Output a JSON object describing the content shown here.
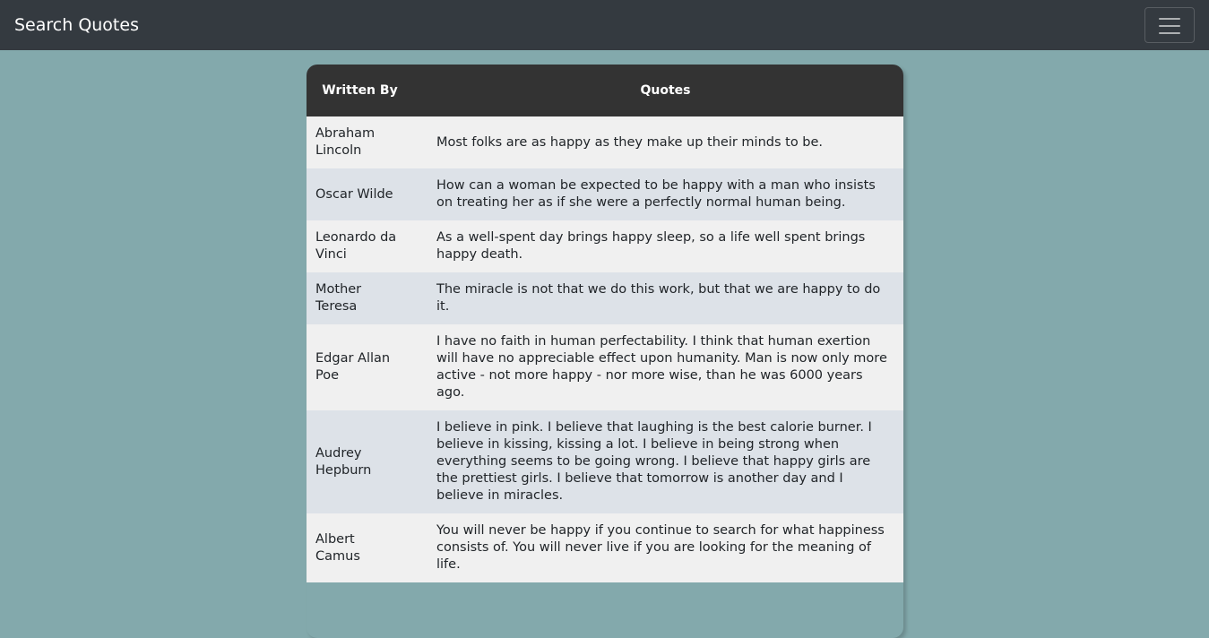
{
  "navbar": {
    "brand": "Search Quotes",
    "toggle_icon": "hamburger-menu-icon"
  },
  "table": {
    "headers": {
      "author": "Written By",
      "quote": "Quotes"
    },
    "rows": [
      {
        "author": "Abraham Lincoln",
        "quote": "Most folks are as happy as they make up their minds to be."
      },
      {
        "author": "Oscar Wilde",
        "quote": "How can a woman be expected to be happy with a man who insists on treating her as if she were a perfectly normal human being."
      },
      {
        "author": "Leonardo da Vinci",
        "quote": "As a well-spent day brings happy sleep, so a life well spent brings happy death."
      },
      {
        "author": "Mother Teresa",
        "quote": "The miracle is not that we do this work, but that we are happy to do it."
      },
      {
        "author": "Edgar Allan Poe",
        "quote": "I have no faith in human perfectability. I think that human exertion will have no appreciable effect upon humanity. Man is now only more active - not more happy - nor more wise, than he was 6000 years ago."
      },
      {
        "author": "Audrey Hepburn",
        "quote": "I believe in pink. I believe that laughing is the best calorie burner. I believe in kissing, kissing a lot. I believe in being strong when everything seems to be going wrong. I believe that happy girls are the prettiest girls. I believe that tomorrow is another day and I believe in miracles."
      },
      {
        "author": "Albert Camus",
        "quote": "You will never be happy if you continue to search for what happiness consists of. You will never live if you are looking for the meaning of life."
      }
    ]
  },
  "colors": {
    "navbar_bg": "#343a40",
    "page_bg": "#83a9ac",
    "header_bg": "#333333",
    "row_odd": "#f0f0f0",
    "row_even": "#dde2e8"
  }
}
